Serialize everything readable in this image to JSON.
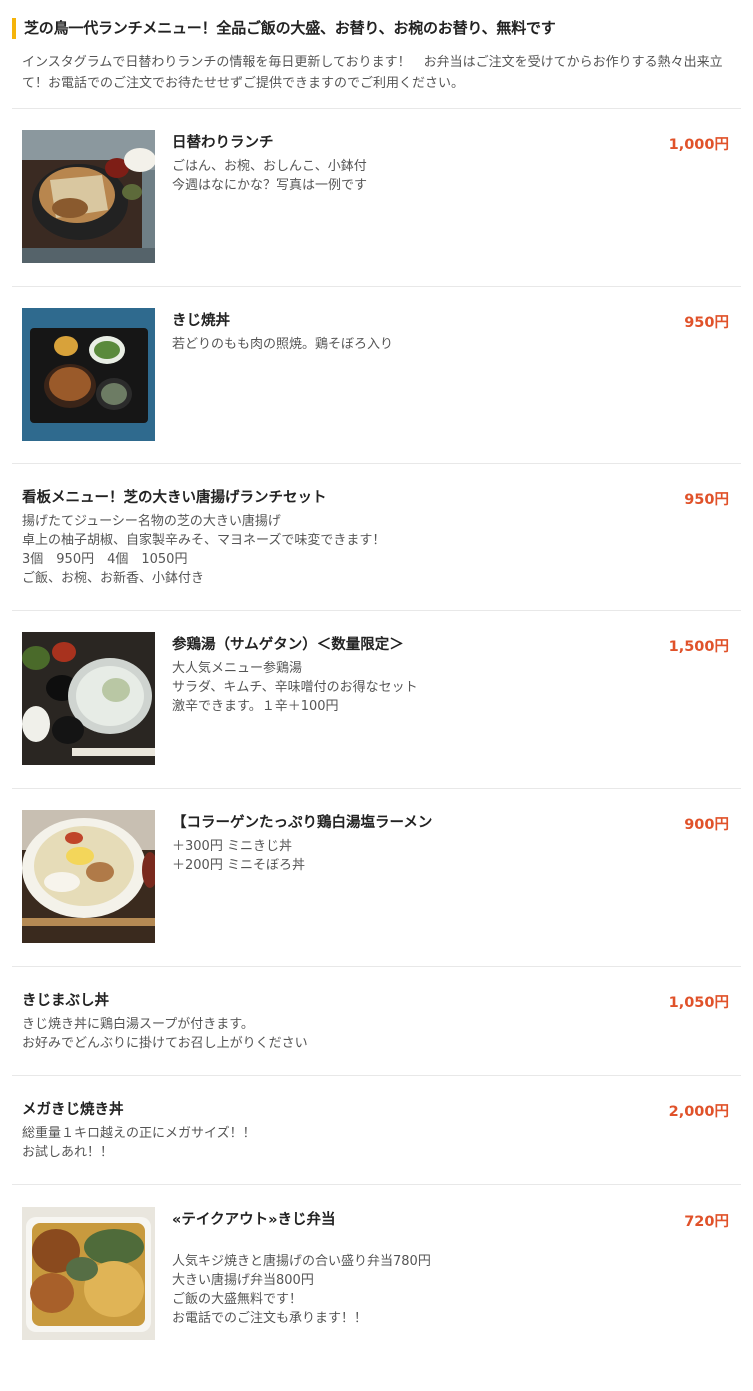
{
  "section": {
    "title": "芝の鳥一代ランチメニュー！全品ご飯の大盛、お替り、お椀のお替り、無料です",
    "intro": "インスタグラムで日替わりランチの情報を毎日更新しております！　お弁当はご注文を受けてからお作りする熱々出来立て！お電話でのご注文でお待たせせずご提供できますのでご利用ください。",
    "accent_color": "#f5b40b"
  },
  "price_color": "#e0522a",
  "items": [
    {
      "name": "日替わりランチ",
      "price": "1,000円",
      "desc": [
        "ごはん、お椀、おしんこ、小鉢付",
        "今週はなにかな？写真は一例です"
      ],
      "image": "karaage-plate-photo"
    },
    {
      "name": "きじ焼丼",
      "price": "950円",
      "desc": [
        "若どりのもも肉の照焼。鶏そぼろ入り"
      ],
      "image": "kiji-don-tray-photo"
    },
    {
      "name": "看板メニュー！芝の大きい唐揚げランチセット",
      "price": "950円",
      "desc": [
        "揚げたてジューシー名物の芝の大きい唐揚げ",
        "卓上の柚子胡椒、自家製辛みそ、マヨネーズで味変できます！",
        "3個　950円　4個　1050円",
        "ご飯、お椀、お新香、小鉢付き"
      ]
    },
    {
      "name": "参鶏湯（サムゲタン）＜数量限定＞",
      "price": "1,500円",
      "desc": [
        "大人気メニュー参鶏湯",
        "サラダ、キムチ、辛味噌付のお得なセット",
        "激辛できます。１辛＋100円"
      ],
      "image": "samgyetang-set-photo"
    },
    {
      "name": "【コラーゲンたっぷり鶏白湯塩ラーメン",
      "price": "900円",
      "desc": [
        "＋300円 ミニきじ丼",
        "＋200円 ミニそぼろ丼"
      ],
      "image": "ramen-bowl-photo"
    },
    {
      "name": "きじまぶし丼",
      "price": "1,050円",
      "desc": [
        "きじ焼き丼に鶏白湯スープが付きます。",
        "お好みでどんぶりに掛けてお召し上がりください"
      ]
    },
    {
      "name": "メガきじ焼き丼",
      "price": "2,000円",
      "desc": [
        "総重量１キロ越えの正にメガサイズ！！",
        "お試しあれ！！"
      ]
    },
    {
      "name": "«テイクアウト»きじ弁当",
      "price": "720円",
      "desc": [
        "人気キジ焼きと唐揚げの合い盛り弁当780円",
        "大きい唐揚げ弁当800円",
        "ご飯の大盛無料です！",
        "お電話でのご注文も承ります！！"
      ],
      "image": "bento-box-photo"
    }
  ]
}
